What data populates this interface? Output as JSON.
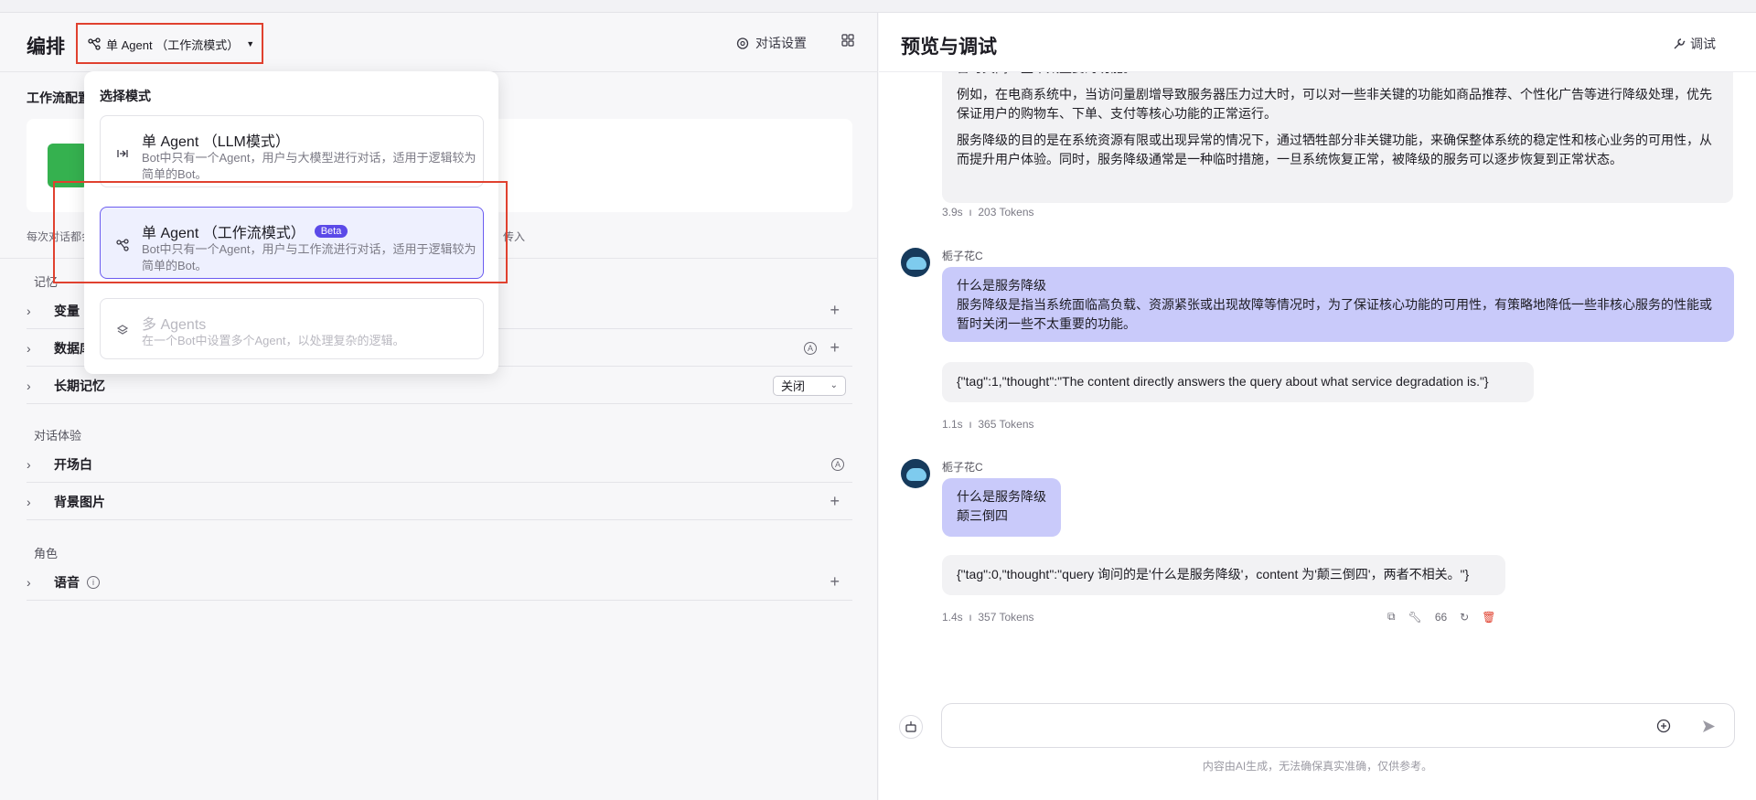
{
  "left": {
    "title": "编排",
    "mode_button": "单 Agent （工作流模式）",
    "dialog_settings": "对话设置",
    "workflow_label": "工作流配置",
    "workflow_note_left": "每次对话都会",
    "workflow_note_right": "传入",
    "memory_section": "记忆",
    "rows_memory": [
      {
        "label": "变量"
      },
      {
        "label": "数据库"
      },
      {
        "label": "长期记忆",
        "select": "关闭"
      }
    ],
    "experience_section": "对话体验",
    "rows_experience": [
      {
        "label": "开场白"
      },
      {
        "label": "背景图片"
      }
    ],
    "role_section": "角色",
    "rows_role": [
      {
        "label": "语音"
      }
    ]
  },
  "dropdown": {
    "title": "选择模式",
    "options": [
      {
        "title": "单 Agent （LLM模式）",
        "desc": "Bot中只有一个Agent，用户与大模型进行对话，适用于逻辑较为简单的Bot。"
      },
      {
        "title": "单 Agent （工作流模式）",
        "badge": "Beta",
        "desc": "Bot中只有一个Agent，用户与工作流进行对话，适用于逻辑较为简单的Bot。"
      },
      {
        "title": "多 Agents",
        "desc": "在一个Bot中设置多个Agent，以处理复杂的逻辑。"
      }
    ]
  },
  "right": {
    "title": "预览与调试",
    "debug": "调试",
    "msg0": {
      "line0": "暂时关闭一些不太重要的功能。",
      "para1": "例如，在电商系统中，当访问量剧增导致服务器压力过大时，可以对一些非关键的功能如商品推荐、个性化广告等进行降级处理，优先保证用户的购物车、下单、支付等核心功能的正常运行。",
      "para2": "服务降级的目的是在系统资源有限或出现异常的情况下，通过牺牲部分非关键功能，来确保整体系统的稳定性和核心业务的可用性，从而提升用户体验。同时，服务降级通常是一种临时措施，一旦系统恢复正常，被降级的服务可以逐步恢复到正常状态。",
      "meta_time": "3.9s",
      "meta_tokens": "203 Tokens"
    },
    "user1": {
      "name": "栀子花C",
      "line1": "什么是服务降级",
      "line2": "服务降级是指当系统面临高负载、资源紧张或出现故障等情况时，为了保证核心功能的可用性，有策略地降低一些非核心服务的性能或暂时关闭一些不太重要的功能。"
    },
    "reply1": {
      "text": "{\"tag\":1,\"thought\":\"The content directly answers the query about what service degradation is.\"}",
      "meta_time": "1.1s",
      "meta_tokens": "365 Tokens"
    },
    "user2": {
      "name": "栀子花C",
      "line1": "什么是服务降级",
      "line2": "颠三倒四"
    },
    "reply2": {
      "text": "{\"tag\":0,\"thought\":\"query 询问的是'什么是服务降级'，content 为'颠三倒四'，两者不相关。\"}",
      "meta_time": "1.4s",
      "meta_tokens": "357 Tokens"
    },
    "action_quote": "66",
    "input_placeholder": "",
    "footer": "内容由AI生成，无法确保真实准确，仅供参考。"
  }
}
